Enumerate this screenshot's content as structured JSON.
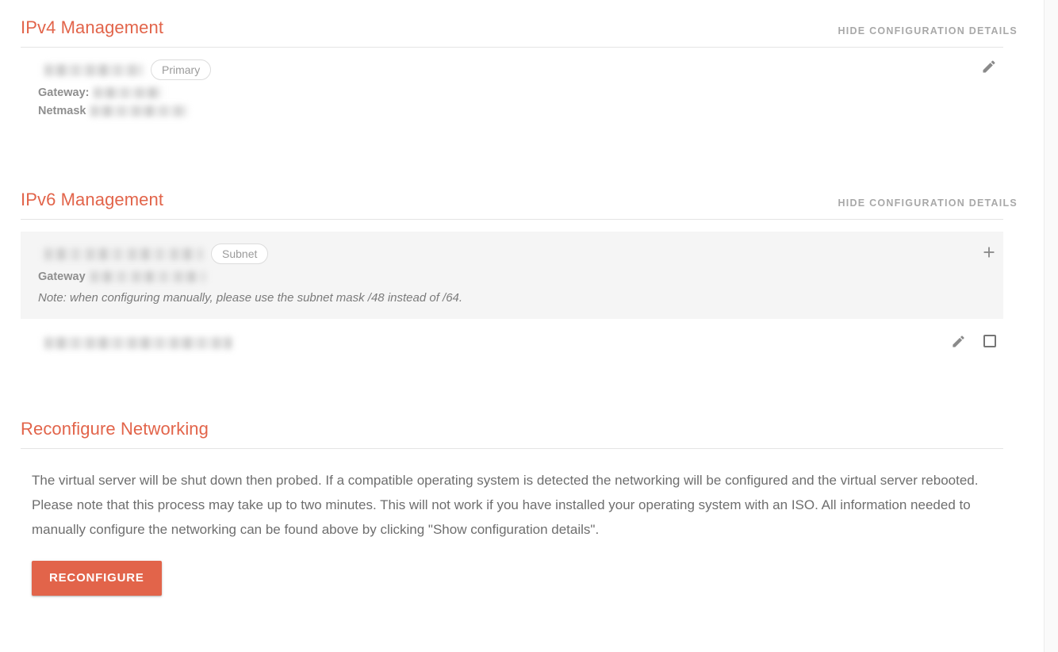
{
  "colors": {
    "accent": "#E2644A",
    "heading": "#E2644A",
    "muted_label": "#A8A8A8",
    "body_text": "#6E6E6E",
    "panel_bg": "#F5F5F5",
    "divider": "#E4E4E4",
    "button_bg": "#E2644A",
    "button_text": "#FFFFFF"
  },
  "ipv4_section": {
    "title": "IPv4 Management",
    "toggle_label": "HIDE CONFIGURATION DETAILS",
    "rows": [
      {
        "address": "",
        "address_redacted": true,
        "badge": "Primary",
        "fields": [
          {
            "label": "Gateway:",
            "value": "",
            "value_redacted": true
          },
          {
            "label": "Netmask",
            "value": "",
            "value_redacted": true
          }
        ],
        "actions": [
          {
            "name": "edit-icon",
            "label": "Edit"
          }
        ]
      }
    ]
  },
  "ipv6_section": {
    "title": "IPv6 Management",
    "toggle_label": "HIDE CONFIGURATION DETAILS",
    "rows": [
      {
        "shaded": true,
        "address": "",
        "address_redacted": true,
        "badge": "Subnet",
        "fields": [
          {
            "label": "Gateway",
            "value": "",
            "value_redacted": true
          }
        ],
        "note": "Note: when configuring manually, please use the subnet mask /48 instead of /64.",
        "actions": [
          {
            "name": "add-icon",
            "label": "+"
          }
        ]
      },
      {
        "shaded": false,
        "address": "",
        "address_redacted": true,
        "badge": "",
        "fields": [],
        "note": "",
        "actions": [
          {
            "name": "edit-icon",
            "label": "Edit"
          },
          {
            "name": "select-checkbox",
            "label": "",
            "checked": false
          }
        ]
      }
    ]
  },
  "reconfigure_section": {
    "title": "Reconfigure Networking",
    "description": "The virtual server will be shut down then probed. If a compatible operating system is detected the networking will be configured and the virtual server rebooted. Please note that this process may take up to two minutes. This will not work if you have installed your operating system with an ISO. All information needed to manually configure the networking can be found above by clicking \"Show configuration details\".",
    "button_label": "RECONFIGURE"
  }
}
